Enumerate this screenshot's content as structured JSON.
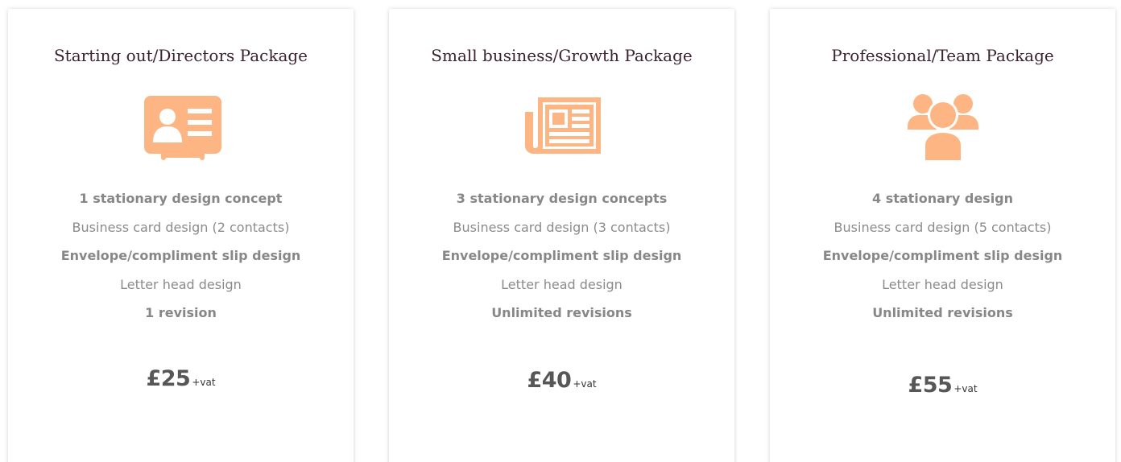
{
  "colors": {
    "accent": "#fdb683",
    "title": "#3b2231",
    "feature_text": "#8b8b8b",
    "price_text": "#575757"
  },
  "packages": [
    {
      "title": "Starting out/Directors Package",
      "icon": "id-card-icon",
      "features": [
        {
          "text": "1 stationary design concept",
          "bold": true
        },
        {
          "text": "Business card design (2 contacts)",
          "bold": false
        },
        {
          "text": "Envelope/compliment slip design",
          "bold": true
        },
        {
          "text": "Letter head design",
          "bold": false
        },
        {
          "text": "1 revision",
          "bold": true
        }
      ],
      "price": "£25",
      "price_suffix": "+vat"
    },
    {
      "title": "Small business/Growth Package",
      "icon": "newspaper-icon",
      "features": [
        {
          "text": "3 stationary design concepts",
          "bold": true
        },
        {
          "text": "Business card design (3 contacts)",
          "bold": false
        },
        {
          "text": "Envelope/compliment slip design",
          "bold": true
        },
        {
          "text": "Letter head design",
          "bold": false
        },
        {
          "text": "Unlimited revisions",
          "bold": true
        }
      ],
      "price": "£40",
      "price_suffix": "+vat"
    },
    {
      "title": "Professional/Team Package",
      "icon": "users-group-icon",
      "features": [
        {
          "text": "4 stationary design",
          "bold": true
        },
        {
          "text": "Business card design (5 contacts)",
          "bold": false
        },
        {
          "text": "Envelope/compliment slip design",
          "bold": true
        },
        {
          "text": "Letter head design",
          "bold": false
        },
        {
          "text": "Unlimited revisions",
          "bold": true
        }
      ],
      "price": "£55",
      "price_suffix": "+vat"
    }
  ]
}
